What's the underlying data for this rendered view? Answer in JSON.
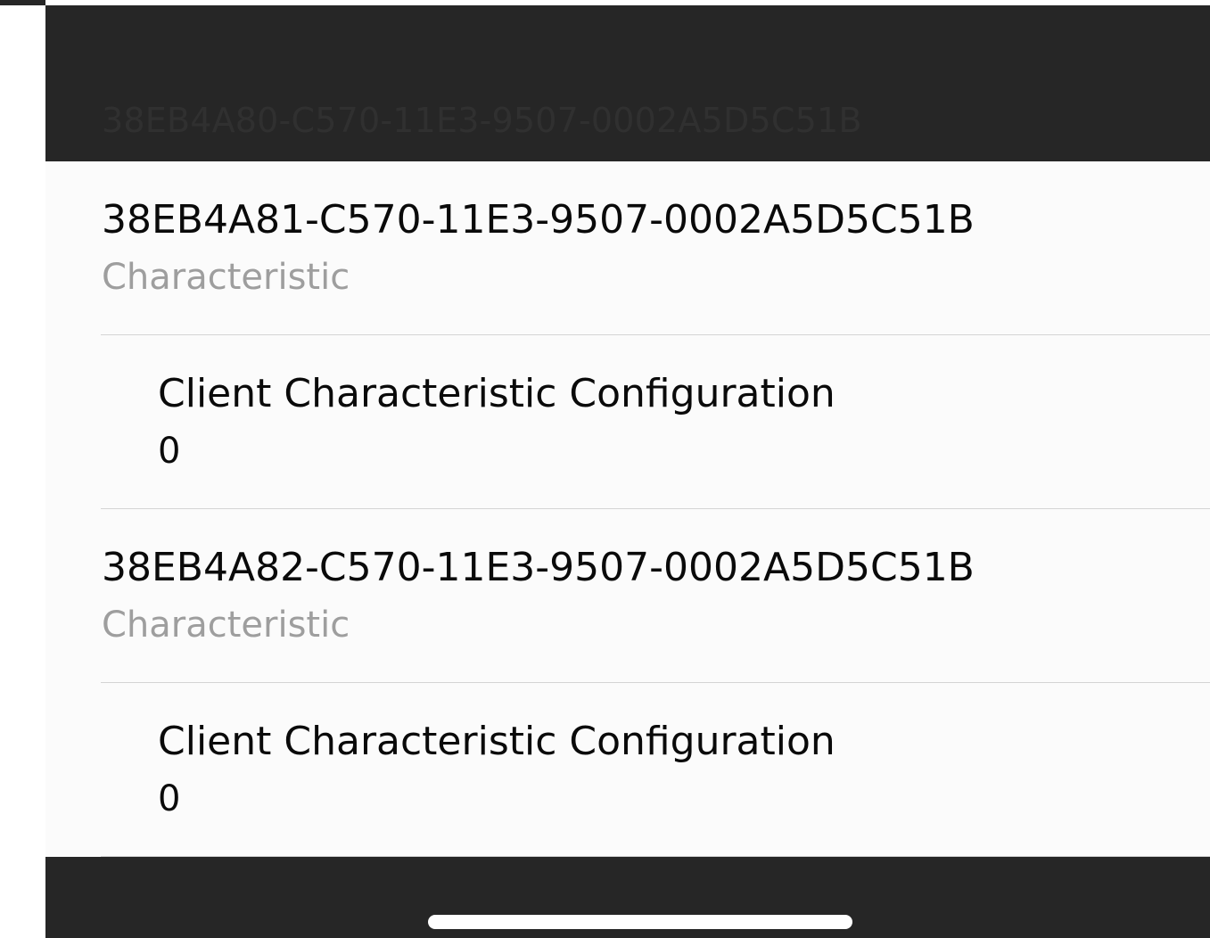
{
  "header": {
    "service_uuid": "38EB4A80-C570-11E3-9507-0002A5D5C51B"
  },
  "rows": [
    {
      "kind": "characteristic",
      "title": "38EB4A81-C570-11E3-9507-0002A5D5C51B",
      "subtitle": "Characteristic"
    },
    {
      "kind": "descriptor",
      "title": "Client Characteristic Configuration",
      "subtitle": "0"
    },
    {
      "kind": "characteristic",
      "title": "38EB4A82-C570-11E3-9507-0002A5D5C51B",
      "subtitle": "Characteristic"
    },
    {
      "kind": "descriptor",
      "title": "Client Characteristic Configuration",
      "subtitle": "0"
    }
  ],
  "colors": {
    "bar_background": "#262626",
    "list_background": "#fbfbfb",
    "primary_text": "#0a0a0a",
    "secondary_text": "#9e9e9e",
    "separator": "#d4d4d4",
    "home_indicator": "#ffffff"
  }
}
